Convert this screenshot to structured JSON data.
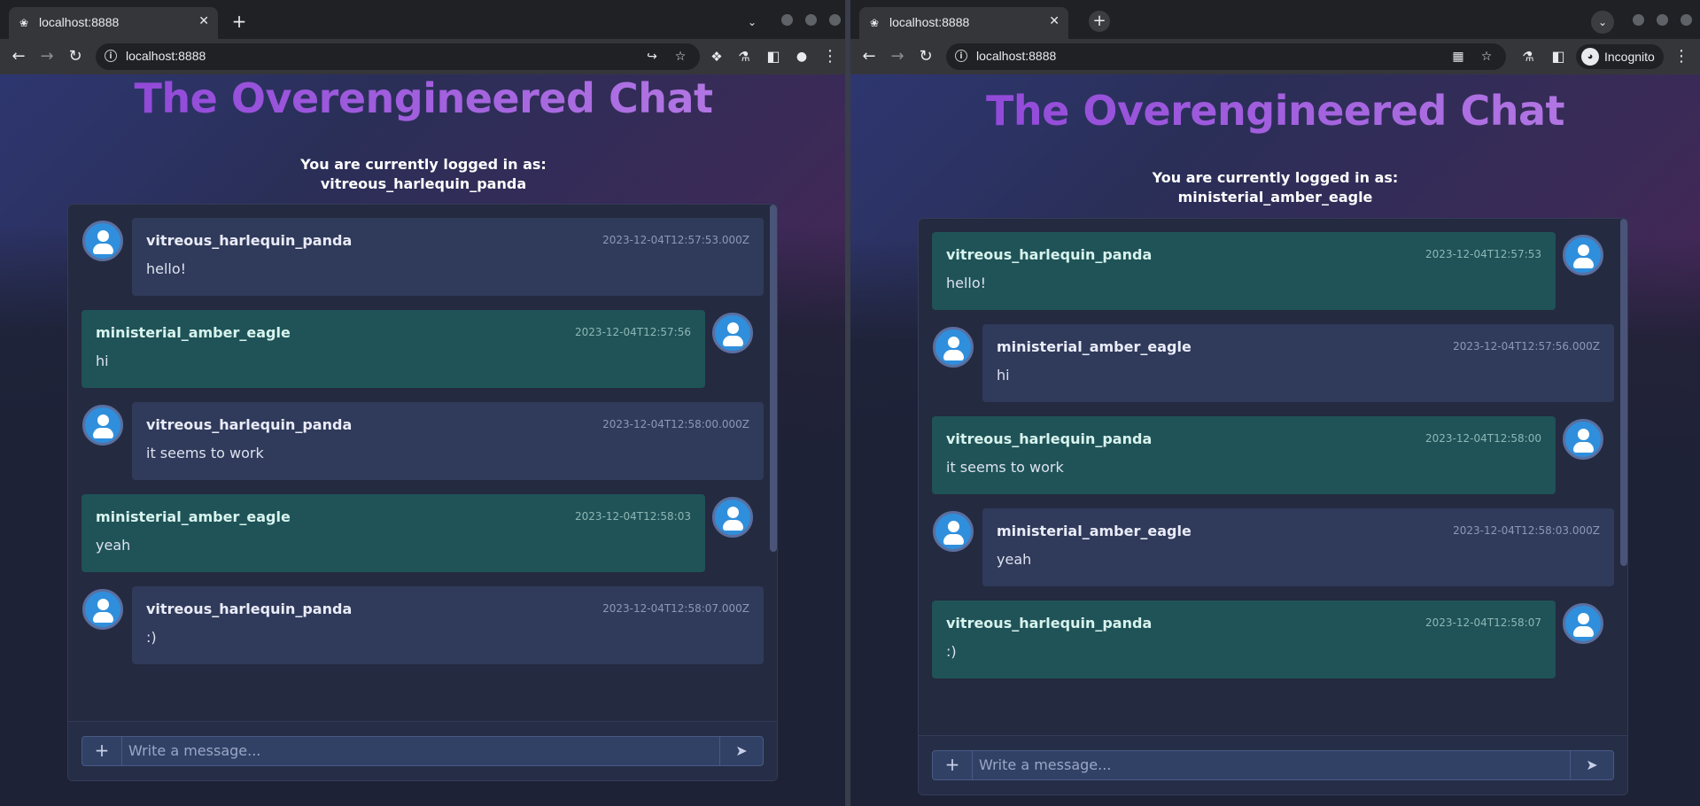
{
  "left": {
    "tab_title": "localhost:8888",
    "url": "localhost:8888",
    "page_title": "The Overengineered Chat",
    "logged_in_label": "You are currently logged in as:",
    "username": "vitreous_harlequin_panda",
    "messages": [
      {
        "user": "vitreous_harlequin_panda",
        "time": "2023-12-04T12:57:53.000Z",
        "text": "hello!"
      },
      {
        "user": "ministerial_amber_eagle",
        "time": "2023-12-04T12:57:56",
        "text": "hi"
      },
      {
        "user": "vitreous_harlequin_panda",
        "time": "2023-12-04T12:58:00.000Z",
        "text": "it seems to work"
      },
      {
        "user": "ministerial_amber_eagle",
        "time": "2023-12-04T12:58:03",
        "text": "yeah"
      },
      {
        "user": "vitreous_harlequin_panda",
        "time": "2023-12-04T12:58:07.000Z",
        "text": ":)"
      }
    ],
    "input_placeholder": "Write a message..."
  },
  "right": {
    "tab_title": "localhost:8888",
    "url": "localhost:8888",
    "incognito_label": "Incognito",
    "page_title": "The Overengineered Chat",
    "logged_in_label": "You are currently logged in as:",
    "username": "ministerial_amber_eagle",
    "messages": [
      {
        "user": "vitreous_harlequin_panda",
        "time": "2023-12-04T12:57:53",
        "text": "hello!"
      },
      {
        "user": "ministerial_amber_eagle",
        "time": "2023-12-04T12:57:56.000Z",
        "text": "hi"
      },
      {
        "user": "vitreous_harlequin_panda",
        "time": "2023-12-04T12:58:00",
        "text": "it seems to work"
      },
      {
        "user": "ministerial_amber_eagle",
        "time": "2023-12-04T12:58:03.000Z",
        "text": "yeah"
      },
      {
        "user": "vitreous_harlequin_panda",
        "time": "2023-12-04T12:58:07",
        "text": ":)"
      }
    ],
    "input_placeholder": "Write a message..."
  },
  "icons": {
    "favicon": "❀",
    "close": "✕",
    "new_tab": "+",
    "tab_search": "⌄",
    "back": "←",
    "forward": "→",
    "reload": "↻",
    "info": "i",
    "share": "↪",
    "bookmark": "☆",
    "extensions": "❖",
    "lab": "⚗",
    "side_panel": "◧",
    "profile": "●",
    "menu": "⋮",
    "qr": "▦",
    "incognito": "◕",
    "attach": "+",
    "send": "➤"
  },
  "colors": {
    "own_message": "#1f5357",
    "other_message": "#303a5a",
    "title_gradient_start": "#8a3fd6",
    "title_gradient_end": "#b980e6",
    "avatar": "#2f8fdc"
  }
}
